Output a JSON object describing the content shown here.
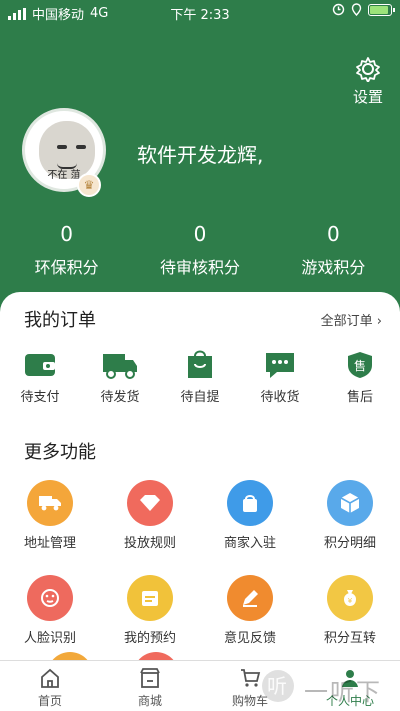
{
  "status_bar": {
    "carrier": "中国移动",
    "network": "4G",
    "time": "下午 2:33"
  },
  "header": {
    "settings_label": "设置",
    "avatar_text": "不在 菹",
    "username": "软件开发龙辉,",
    "points": [
      {
        "value": "0",
        "label": "环保积分"
      },
      {
        "value": "0",
        "label": "待审核积分"
      },
      {
        "value": "0",
        "label": "游戏积分"
      }
    ]
  },
  "orders": {
    "title": "我的订单",
    "all_label": "全部订单",
    "items": [
      {
        "label": "待支付",
        "icon": "wallet-icon"
      },
      {
        "label": "待发货",
        "icon": "truck-icon"
      },
      {
        "label": "待自提",
        "icon": "shopping-bag-icon"
      },
      {
        "label": "待收货",
        "icon": "chat-icon"
      },
      {
        "label": "售后",
        "icon": "shield-icon",
        "icon_text": "售"
      }
    ]
  },
  "features": {
    "title": "更多功能",
    "items": [
      {
        "label": "地址管理",
        "icon": "delivery-truck-icon",
        "color": "#f4a63a"
      },
      {
        "label": "投放规则",
        "icon": "diamond-icon",
        "color": "#f06a5d"
      },
      {
        "label": "商家入驻",
        "icon": "gift-bag-icon",
        "color": "#3f9be8"
      },
      {
        "label": "积分明细",
        "icon": "box-icon",
        "color": "#59a9ea"
      },
      {
        "label": "人脸识别",
        "icon": "face-recognition-icon",
        "color": "#ee6a5e"
      },
      {
        "label": "我的预约",
        "icon": "calendar-icon",
        "color": "#f1c23a"
      },
      {
        "label": "意见反馈",
        "icon": "pencil-icon",
        "color": "#f08b2f"
      },
      {
        "label": "积分互转",
        "icon": "money-bag-icon",
        "color": "#f2c744"
      }
    ]
  },
  "tabbar": [
    {
      "label": "首页",
      "icon": "home-icon"
    },
    {
      "label": "商城",
      "icon": "store-icon"
    },
    {
      "label": "购物车",
      "icon": "cart-icon"
    },
    {
      "label": "个人中心",
      "icon": "profile-icon",
      "active": true
    }
  ],
  "watermark": {
    "logo": "听",
    "text": "一听下载"
  },
  "theme": {
    "primary": "#2e7d4a"
  }
}
